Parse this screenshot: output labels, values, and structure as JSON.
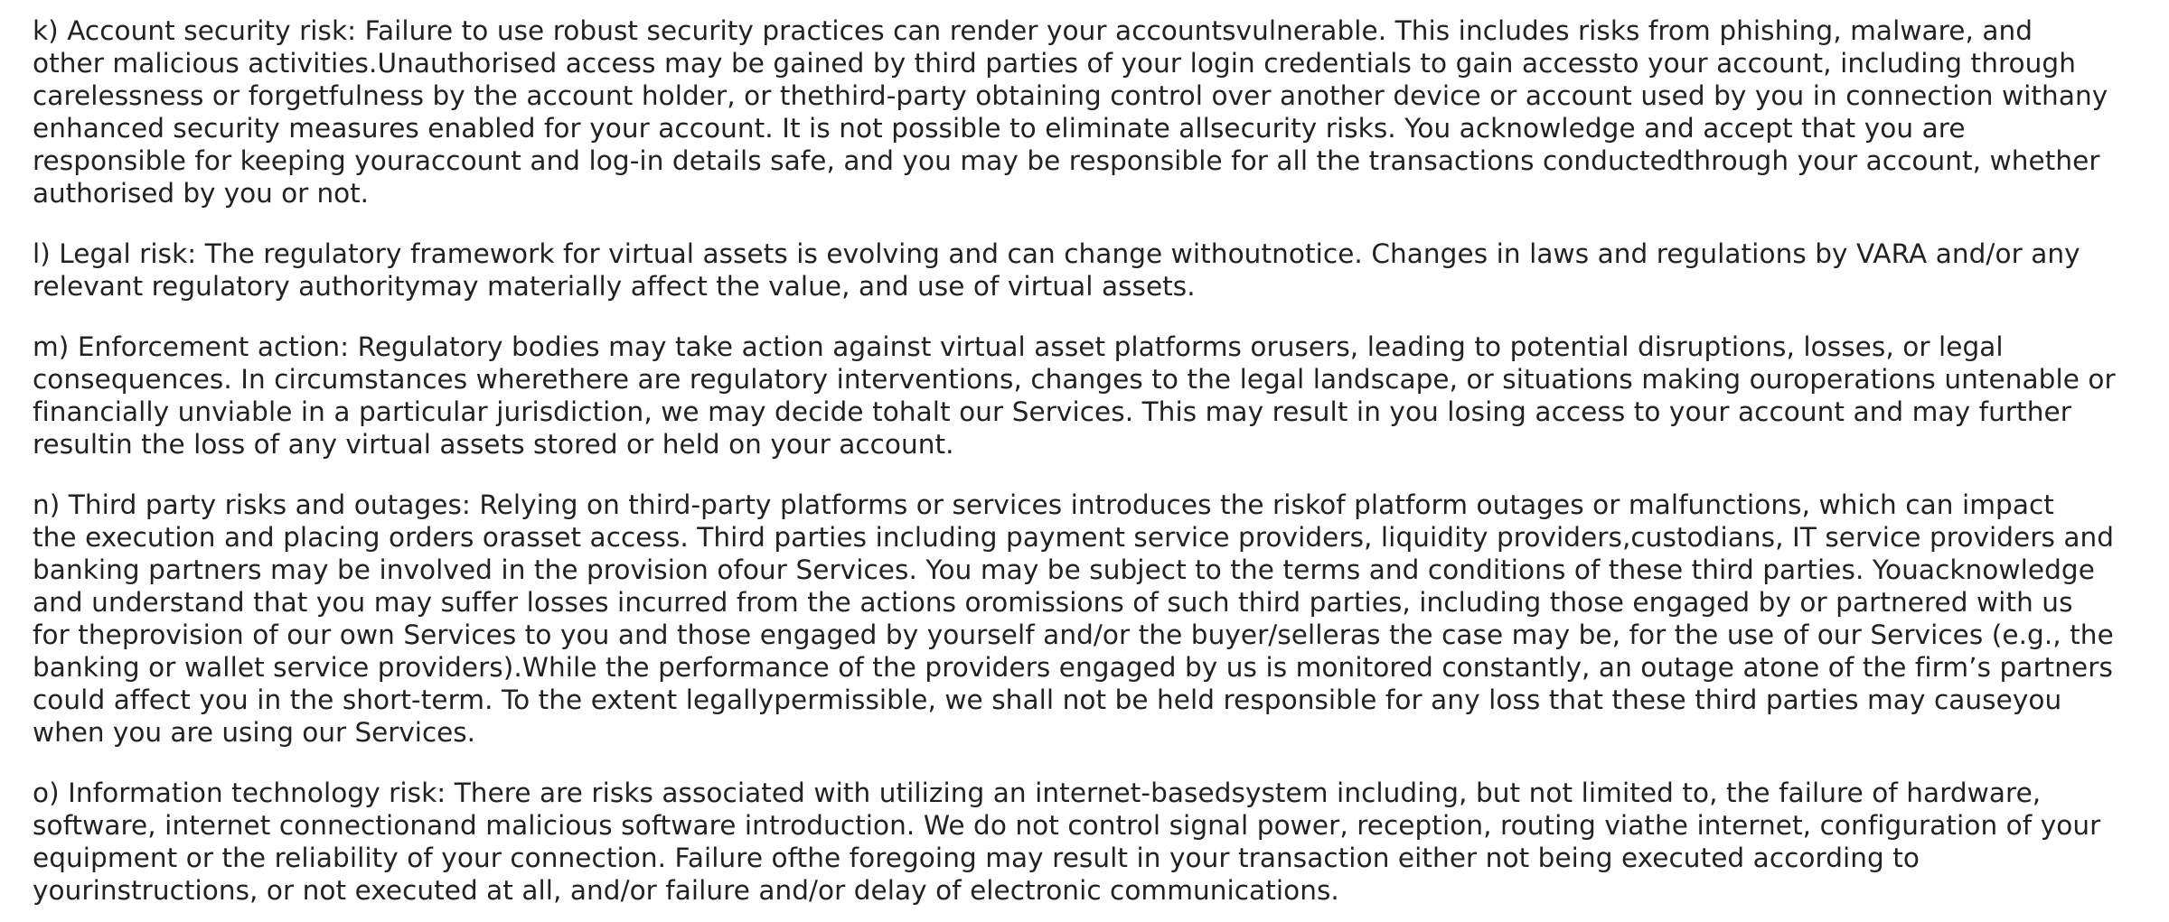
{
  "paragraphs": [
    {
      "lines": [
        "k) Account security risk: Failure to use robust security practices can render your accountsvulnerable. This includes risks from phishing, malware, and",
        "other malicious activities.Unauthorised access may be gained by third parties of your login credentials to gain accessto your account, including through",
        "carelessness or forgetfulness by the account holder, or thethird-party obtaining control over another device or account used by you in connection withany",
        "enhanced security measures enabled for your account. It is not possible to eliminate allsecurity risks. You acknowledge and accept that you are",
        "responsible for keeping youraccount and log-in details safe, and you may be responsible for all the transactions conductedthrough your account, whether",
        "authorised by you or not."
      ]
    },
    {
      "lines": [
        "l) Legal risk: The regulatory framework for virtual assets is evolving and can change withoutnotice. Changes in laws and regulations by VARA and/or any",
        "relevant regulatory authoritymay materially affect the value, and use of virtual assets."
      ]
    },
    {
      "lines": [
        "m) Enforcement action: Regulatory bodies may take action against virtual asset platforms orusers, leading to potential disruptions, losses, or legal",
        "consequences. In circumstances wherethere are regulatory interventions, changes to the legal landscape, or situations making ouroperations untenable or",
        "financially unviable in a particular jurisdiction, we may decide tohalt our Services. This may result in you losing access to your account and may further",
        "resultin the loss of any virtual assets stored or held on your account."
      ]
    },
    {
      "lines": [
        "n) Third party risks and outages: Relying on third-party platforms or services introduces the riskof platform outages or malfunctions, which can impact",
        "the execution and placing orders orasset access. Third parties including payment service providers, liquidity providers,custodians, IT service providers and",
        "banking partners may be involved in the provision ofour Services. You may be subject to the terms and conditions of these third parties. Youacknowledge",
        "and understand that you may suffer losses incurred from the actions oromissions of such third parties, including those engaged by or partnered with us",
        "for theprovision of our own Services to you and those engaged by yourself and/or the buyer/selleras the case may be, for the use of our Services (e.g., the",
        "banking or wallet service providers).While the performance of the providers engaged by us is monitored constantly, an outage atone of the firm’s partners",
        "could affect you in the short-term. To the extent legallypermissible, we shall not be held responsible for any loss that these third parties may causeyou",
        "when you are using our Services."
      ]
    },
    {
      "lines": [
        "o) Information technology risk: There are risks associated with utilizing an internet-basedsystem including, but not limited to, the failure of hardware,",
        "software, internet connectionand malicious software introduction. We do not control signal power, reception, routing viathe internet, configuration of your",
        "equipment or the reliability of your connection. Failure ofthe foregoing may result in your transaction either not being executed according to",
        "yourinstructions, or not executed at all, and/or failure and/or delay of electronic communications."
      ]
    }
  ]
}
